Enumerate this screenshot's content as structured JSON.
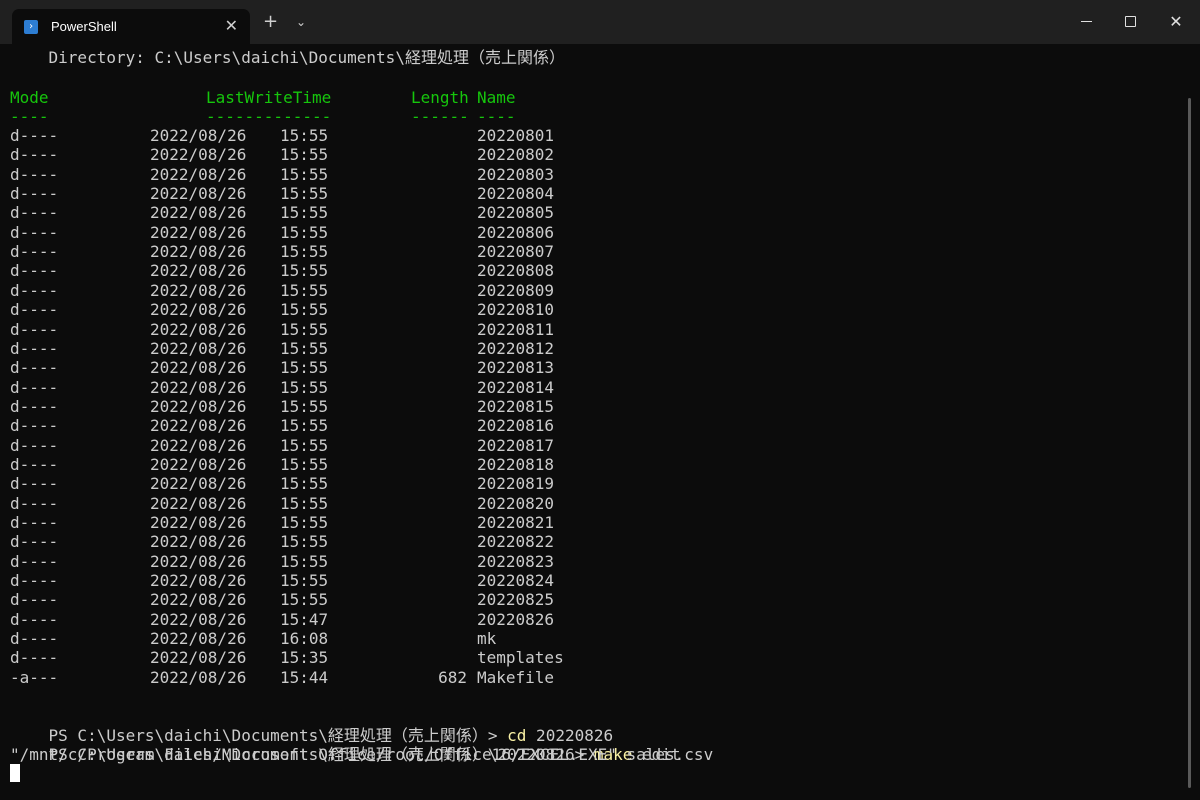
{
  "window": {
    "tab_title": "PowerShell",
    "tab_icon": "powershell-icon",
    "close_tab_glyph": "✕",
    "new_tab_glyph": "+",
    "dropdown_glyph": "⌄",
    "close_window_glyph": "✕"
  },
  "terminal": {
    "directory_line": "    Directory: C:\\Users\\daichi\\Documents\\経理処理（売上関係）",
    "headers": {
      "mode": "Mode",
      "lastwritetime": "LastWriteTime",
      "length": "Length",
      "name": "Name",
      "mode_rule": "----",
      "lastwritetime_rule": "-------------",
      "length_rule": "------",
      "name_rule": "----"
    },
    "rows": [
      {
        "mode": "d----",
        "date": "2022/08/26",
        "time": "15:55",
        "length": "",
        "name": "20220801"
      },
      {
        "mode": "d----",
        "date": "2022/08/26",
        "time": "15:55",
        "length": "",
        "name": "20220802"
      },
      {
        "mode": "d----",
        "date": "2022/08/26",
        "time": "15:55",
        "length": "",
        "name": "20220803"
      },
      {
        "mode": "d----",
        "date": "2022/08/26",
        "time": "15:55",
        "length": "",
        "name": "20220804"
      },
      {
        "mode": "d----",
        "date": "2022/08/26",
        "time": "15:55",
        "length": "",
        "name": "20220805"
      },
      {
        "mode": "d----",
        "date": "2022/08/26",
        "time": "15:55",
        "length": "",
        "name": "20220806"
      },
      {
        "mode": "d----",
        "date": "2022/08/26",
        "time": "15:55",
        "length": "",
        "name": "20220807"
      },
      {
        "mode": "d----",
        "date": "2022/08/26",
        "time": "15:55",
        "length": "",
        "name": "20220808"
      },
      {
        "mode": "d----",
        "date": "2022/08/26",
        "time": "15:55",
        "length": "",
        "name": "20220809"
      },
      {
        "mode": "d----",
        "date": "2022/08/26",
        "time": "15:55",
        "length": "",
        "name": "20220810"
      },
      {
        "mode": "d----",
        "date": "2022/08/26",
        "time": "15:55",
        "length": "",
        "name": "20220811"
      },
      {
        "mode": "d----",
        "date": "2022/08/26",
        "time": "15:55",
        "length": "",
        "name": "20220812"
      },
      {
        "mode": "d----",
        "date": "2022/08/26",
        "time": "15:55",
        "length": "",
        "name": "20220813"
      },
      {
        "mode": "d----",
        "date": "2022/08/26",
        "time": "15:55",
        "length": "",
        "name": "20220814"
      },
      {
        "mode": "d----",
        "date": "2022/08/26",
        "time": "15:55",
        "length": "",
        "name": "20220815"
      },
      {
        "mode": "d----",
        "date": "2022/08/26",
        "time": "15:55",
        "length": "",
        "name": "20220816"
      },
      {
        "mode": "d----",
        "date": "2022/08/26",
        "time": "15:55",
        "length": "",
        "name": "20220817"
      },
      {
        "mode": "d----",
        "date": "2022/08/26",
        "time": "15:55",
        "length": "",
        "name": "20220818"
      },
      {
        "mode": "d----",
        "date": "2022/08/26",
        "time": "15:55",
        "length": "",
        "name": "20220819"
      },
      {
        "mode": "d----",
        "date": "2022/08/26",
        "time": "15:55",
        "length": "",
        "name": "20220820"
      },
      {
        "mode": "d----",
        "date": "2022/08/26",
        "time": "15:55",
        "length": "",
        "name": "20220821"
      },
      {
        "mode": "d----",
        "date": "2022/08/26",
        "time": "15:55",
        "length": "",
        "name": "20220822"
      },
      {
        "mode": "d----",
        "date": "2022/08/26",
        "time": "15:55",
        "length": "",
        "name": "20220823"
      },
      {
        "mode": "d----",
        "date": "2022/08/26",
        "time": "15:55",
        "length": "",
        "name": "20220824"
      },
      {
        "mode": "d----",
        "date": "2022/08/26",
        "time": "15:55",
        "length": "",
        "name": "20220825"
      },
      {
        "mode": "d----",
        "date": "2022/08/26",
        "time": "15:47",
        "length": "",
        "name": "20220826"
      },
      {
        "mode": "d----",
        "date": "2022/08/26",
        "time": "16:08",
        "length": "",
        "name": "mk"
      },
      {
        "mode": "d----",
        "date": "2022/08/26",
        "time": "15:35",
        "length": "",
        "name": "templates"
      },
      {
        "mode": "-a---",
        "date": "2022/08/26",
        "time": "15:44",
        "length": "682",
        "name": "Makefile"
      }
    ],
    "commands": [
      {
        "prompt": "PS C:\\Users\\daichi\\Documents\\経理処理（売上関係）> ",
        "command": "cd",
        "args": " 20220826"
      },
      {
        "prompt": "PS C:\\Users\\daichi\\Documents\\経理処理（売上関係）\\20220826> ",
        "command": "make",
        "args": " edit"
      }
    ],
    "output_line": "\"/mnt/c/Program Files/Microsoft Office/root/Office16/EXCEL.EXE\" sales.csv"
  },
  "colors": {
    "background": "#0c0c0c",
    "text": "#cccccc",
    "header_green": "#16c60c",
    "command_yellow": "#f9f1a5"
  }
}
